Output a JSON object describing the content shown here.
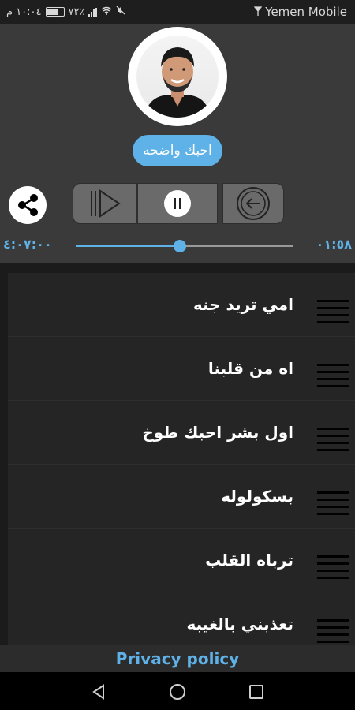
{
  "status_bar": {
    "time": "١٠:٠٤ م",
    "battery": "٧٢٪",
    "carrier": "Yemen Mobile"
  },
  "player": {
    "current_song": "احبك واضحه",
    "elapsed": "٠١:٥٨",
    "duration": "٤:٠٧:٠٠",
    "progress_fraction": 0.48,
    "accent_color": "#5fb2e8"
  },
  "songs": [
    {
      "title": "امي تريد جنه"
    },
    {
      "title": "اه من قلبنا"
    },
    {
      "title": "اول بشر احبك طوخ"
    },
    {
      "title": "بسكولوله"
    },
    {
      "title": "ترباه القلب"
    },
    {
      "title": "تعذبني بالغيبه"
    }
  ],
  "footer": {
    "privacy_label": "Privacy policy"
  },
  "icons": {
    "share": "share-icon",
    "next": "skip-next-icon",
    "pause": "pause-icon",
    "previous": "previous-icon",
    "drag": "drag-handle-icon"
  }
}
